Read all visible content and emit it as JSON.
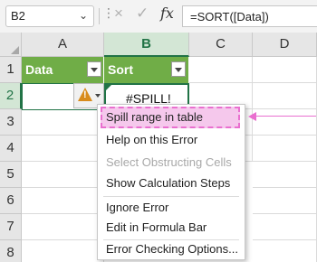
{
  "formula_bar": {
    "name_box": "B2",
    "cancel_icon": "×",
    "enter_icon": "✓",
    "fx_label": "fx",
    "formula": "=SORT([Data])"
  },
  "columns": [
    "A",
    "B",
    "C",
    "D"
  ],
  "selected_column": "B",
  "rows": [
    "1",
    "2",
    "3",
    "4",
    "5",
    "6",
    "7",
    "8"
  ],
  "selected_row": "2",
  "table": {
    "headers": [
      "Data",
      "Sort"
    ],
    "header_color": "#70ad47"
  },
  "active_cell": {
    "ref": "B2",
    "value": "#SPILL!"
  },
  "error_button": {
    "icon": "warning-icon"
  },
  "context_menu": {
    "highlighted_item": "Spill range in table",
    "items": [
      {
        "label": "Spill range in table",
        "enabled": true
      },
      {
        "label": "Help on this Error",
        "enabled": true
      },
      {
        "label": "Select Obstructing Cells",
        "enabled": false
      },
      {
        "label": "Show Calculation Steps",
        "enabled": true
      },
      {
        "label": "Ignore Error",
        "enabled": true
      },
      {
        "label": "Edit in Formula Bar",
        "enabled": true
      },
      {
        "label": "Error Checking Options...",
        "enabled": true
      }
    ]
  },
  "colors": {
    "accent_green": "#217346",
    "highlight_pink": "#e96fcf",
    "warning_orange": "#d88b1c"
  }
}
